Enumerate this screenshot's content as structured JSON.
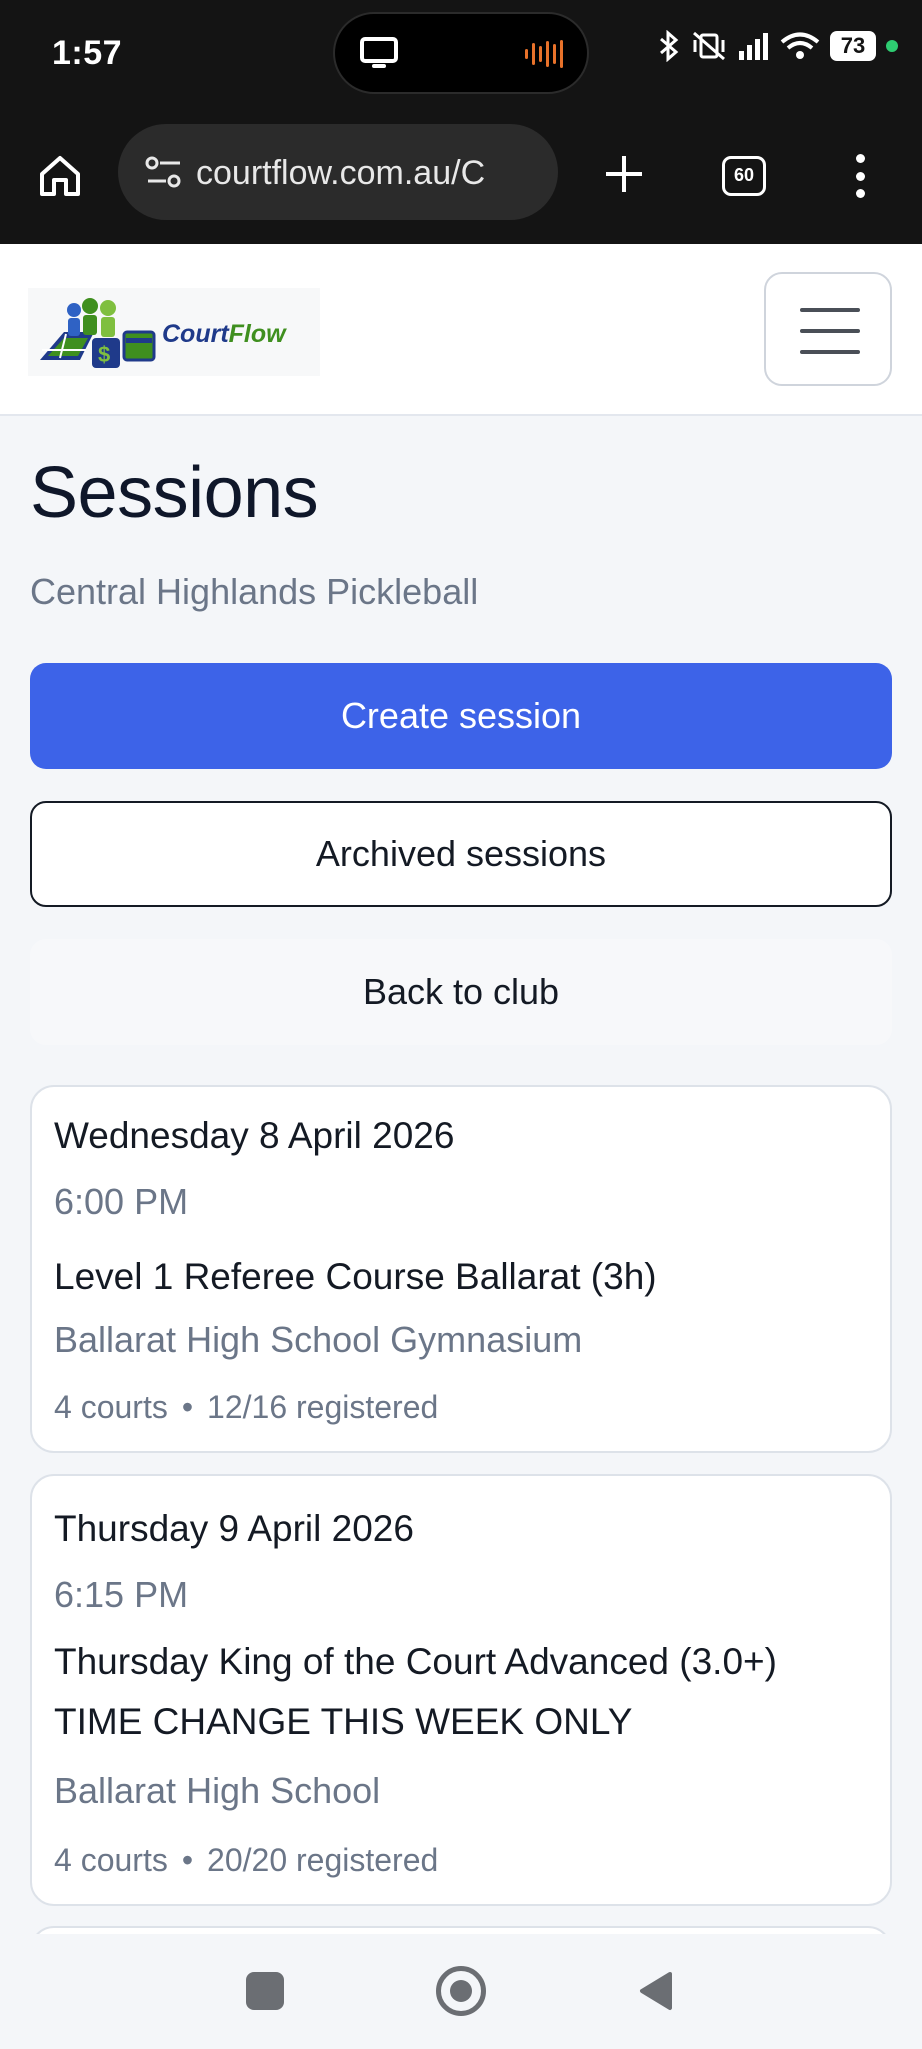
{
  "status_bar": {
    "time": "1:57",
    "battery": "73",
    "icons": [
      "cast-icon",
      "equalizer-icon",
      "bluetooth-icon",
      "vibrate-off-icon",
      "signal-icon",
      "wifi-icon",
      "battery-icon"
    ]
  },
  "browser": {
    "url": "courtflow.com.au/C",
    "tab_count": "60"
  },
  "header": {
    "logo_court": "Court",
    "logo_flow": "Flow",
    "brand_colors": {
      "blue": "#1f3a8a",
      "green": "#3f8f1f"
    }
  },
  "page": {
    "title": "Sessions",
    "subtitle": "Central Highlands Pickleball"
  },
  "actions": {
    "create_session": "Create session",
    "archived_sessions": "Archived sessions",
    "back_to_club": "Back to club"
  },
  "accent_color": "#3d63e8",
  "sessions": [
    {
      "date": "Wednesday 8 April 2026",
      "time": "6:00 PM",
      "title": "Level 1 Referee Course Ballarat (3h)",
      "venue": "Ballarat High School Gymnasium",
      "courts": "4 courts",
      "registered": "12/16 registered"
    },
    {
      "date": "Thursday 9 April 2026",
      "time": "6:15 PM",
      "title": "Thursday King of the Court Advanced (3.0+) TIME CHANGE THIS WEEK ONLY",
      "venue": "Ballarat High School",
      "courts": "4 courts",
      "registered": "20/20 registered"
    }
  ],
  "separator": "•"
}
